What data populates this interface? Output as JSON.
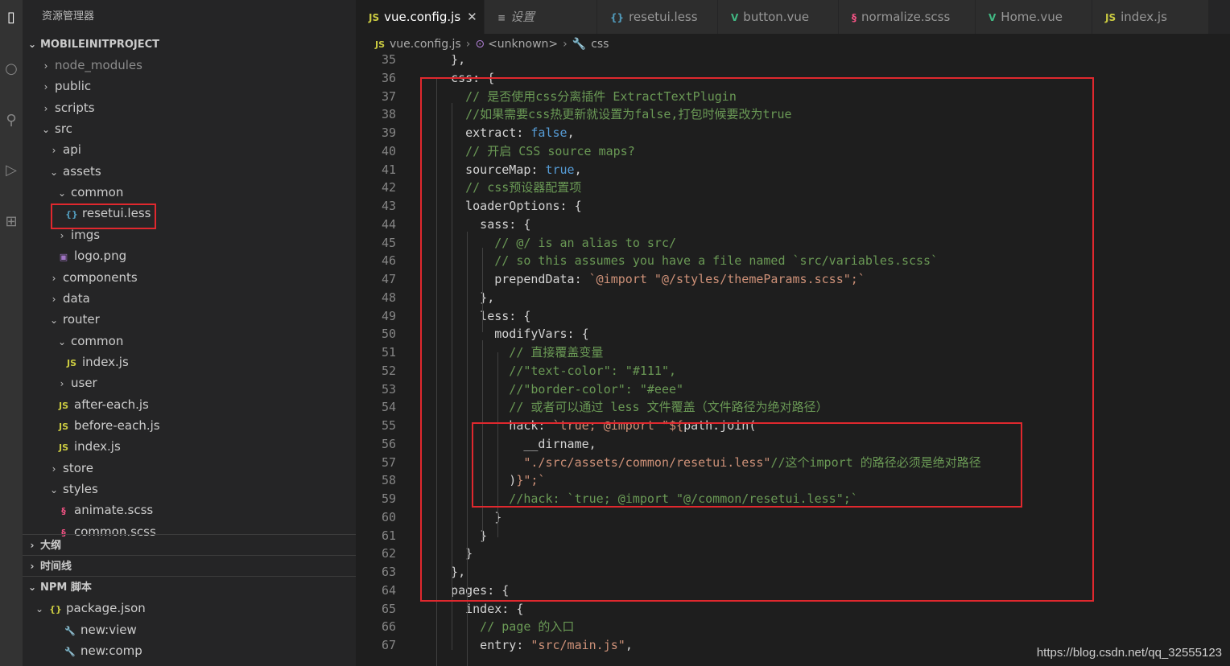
{
  "explorer": {
    "title": "资源管理器",
    "project": "MOBILEINITPROJECT",
    "items": [
      {
        "label": "node_modules",
        "depth": 0,
        "kind": "folder",
        "open": false,
        "dim": true
      },
      {
        "label": "public",
        "depth": 0,
        "kind": "folder",
        "open": false
      },
      {
        "label": "scripts",
        "depth": 0,
        "kind": "folder",
        "open": false
      },
      {
        "label": "src",
        "depth": 0,
        "kind": "folder",
        "open": true
      },
      {
        "label": "api",
        "depth": 1,
        "kind": "folder",
        "open": false
      },
      {
        "label": "assets",
        "depth": 1,
        "kind": "folder",
        "open": true
      },
      {
        "label": "common",
        "depth": 2,
        "kind": "folder",
        "open": true
      },
      {
        "label": "resetui.less",
        "depth": 3,
        "kind": "less"
      },
      {
        "label": "imgs",
        "depth": 2,
        "kind": "folder",
        "open": false
      },
      {
        "label": "logo.png",
        "depth": 2,
        "kind": "png"
      },
      {
        "label": "components",
        "depth": 1,
        "kind": "folder",
        "open": false
      },
      {
        "label": "data",
        "depth": 1,
        "kind": "folder",
        "open": false
      },
      {
        "label": "router",
        "depth": 1,
        "kind": "folder",
        "open": true
      },
      {
        "label": "common",
        "depth": 2,
        "kind": "folder",
        "open": true
      },
      {
        "label": "index.js",
        "depth": 3,
        "kind": "js"
      },
      {
        "label": "user",
        "depth": 2,
        "kind": "folder",
        "open": false
      },
      {
        "label": "after-each.js",
        "depth": 2,
        "kind": "js"
      },
      {
        "label": "before-each.js",
        "depth": 2,
        "kind": "js"
      },
      {
        "label": "index.js",
        "depth": 2,
        "kind": "js"
      },
      {
        "label": "store",
        "depth": 1,
        "kind": "folder",
        "open": false
      },
      {
        "label": "styles",
        "depth": 1,
        "kind": "folder",
        "open": true
      },
      {
        "label": "animate.scss",
        "depth": 2,
        "kind": "scss"
      },
      {
        "label": "common.scss",
        "depth": 2,
        "kind": "scss"
      }
    ],
    "outline": "大纲",
    "timeline": "时间线",
    "npm": "NPM 脚本",
    "npm_items": [
      {
        "label": "package.json",
        "kind": "json",
        "depth": 1
      },
      {
        "label": "new:view",
        "kind": "npm",
        "depth": 2
      },
      {
        "label": "new:comp",
        "kind": "npm",
        "depth": 2
      }
    ]
  },
  "tabs": [
    {
      "label": "vue.config.js",
      "icon": "JS",
      "kind": "js",
      "active": true,
      "close": "✕"
    },
    {
      "label": "设置",
      "icon": "≡",
      "kind": "settings",
      "italic": true
    },
    {
      "label": "resetui.less",
      "icon": "{}",
      "kind": "less"
    },
    {
      "label": "button.vue",
      "icon": "V",
      "kind": "vue"
    },
    {
      "label": "normalize.scss",
      "icon": "§",
      "kind": "scss"
    },
    {
      "label": "Home.vue",
      "icon": "V",
      "kind": "vue"
    },
    {
      "label": "index.js",
      "icon": "JS",
      "kind": "js"
    }
  ],
  "breadcrumb": {
    "file_icon": "JS",
    "file": "vue.config.js",
    "mid": "<unknown>",
    "last": "css"
  },
  "code": {
    "start": 35,
    "lines": [
      [
        [
          "  },",
          "t"
        ]
      ],
      [
        [
          "  css: {",
          "t"
        ]
      ],
      [
        [
          "    // 是否使用css分离插件 ExtractTextPlugin",
          "cm"
        ]
      ],
      [
        [
          "    //如果需要css热更新就设置为false,打包时候要改为true",
          "cm"
        ]
      ],
      [
        [
          "    extract: ",
          "t"
        ],
        [
          "false",
          "kw"
        ],
        [
          ",",
          "t"
        ]
      ],
      [
        [
          "    // 开启 CSS source maps?",
          "cm"
        ]
      ],
      [
        [
          "    sourceMap: ",
          "t"
        ],
        [
          "true",
          "kw"
        ],
        [
          ",",
          "t"
        ]
      ],
      [
        [
          "    // css预设器配置项",
          "cm"
        ]
      ],
      [
        [
          "    loaderOptions: {",
          "t"
        ]
      ],
      [
        [
          "      sass: {",
          "t"
        ]
      ],
      [
        [
          "        // @/ is an alias to src/",
          "cm"
        ]
      ],
      [
        [
          "        // so this assumes you have a file named `src/variables.scss`",
          "cm"
        ]
      ],
      [
        [
          "        prependData: ",
          "t"
        ],
        [
          "`@import \"@/styles/themeParams.scss\";`",
          "str"
        ]
      ],
      [
        [
          "      },",
          "t"
        ]
      ],
      [
        [
          "      less: {",
          "t"
        ]
      ],
      [
        [
          "        modifyVars: {",
          "t"
        ]
      ],
      [
        [
          "          // 直接覆盖变量",
          "cm"
        ]
      ],
      [
        [
          "          //\"text-color\": \"#111\",",
          "cm"
        ]
      ],
      [
        [
          "          //\"border-color\": \"#eee\"",
          "cm"
        ]
      ],
      [
        [
          "          // 或者可以通过 less 文件覆盖（文件路径为绝对路径）",
          "cm"
        ]
      ],
      [
        [
          "          hack: ",
          "t"
        ],
        [
          "`true; @import \"${",
          "str"
        ],
        [
          "path.join(",
          "t"
        ]
      ],
      [
        [
          "            __dirname,",
          "t"
        ]
      ],
      [
        [
          "            ",
          "t"
        ],
        [
          "\"./src/assets/common/resetui.less\"",
          "str"
        ],
        [
          "//这个import 的路径必须是绝对路径",
          "cm"
        ]
      ],
      [
        [
          "          )",
          "t"
        ],
        [
          "}\";`",
          "str"
        ]
      ],
      [
        [
          "          //hack: `true; @import \"@/common/resetui.less\";`",
          "cm"
        ]
      ],
      [
        [
          "        }",
          "t"
        ]
      ],
      [
        [
          "      }",
          "t"
        ]
      ],
      [
        [
          "    }",
          "t"
        ]
      ],
      [
        [
          "  },",
          "t"
        ]
      ],
      [
        [
          "  pages: {",
          "t"
        ]
      ],
      [
        [
          "    index: {",
          "t"
        ]
      ],
      [
        [
          "      // page 的入口",
          "cm"
        ]
      ],
      [
        [
          "      entry: ",
          "t"
        ],
        [
          "\"src/main.js\"",
          "str"
        ],
        [
          ",",
          "t"
        ]
      ]
    ]
  },
  "watermark": "https://blog.csdn.net/qq_32555123",
  "colors": {
    "highlight": "#e0282e",
    "comment": "#6a9955",
    "keyword": "#569cd6",
    "string": "#ce9178"
  }
}
